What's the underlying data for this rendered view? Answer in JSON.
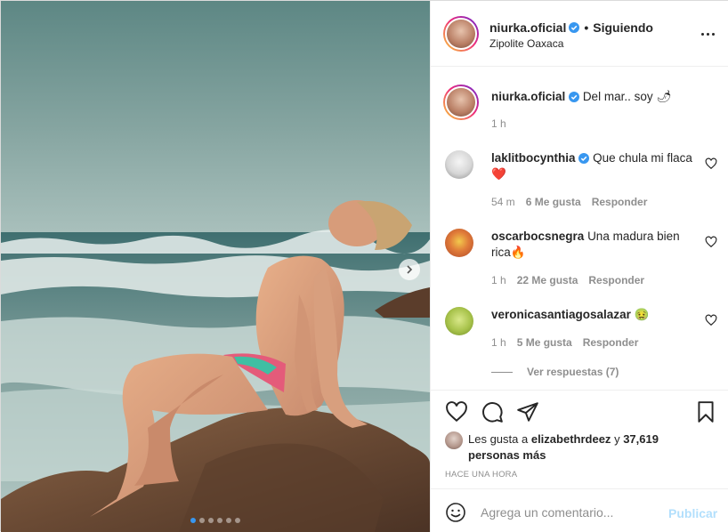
{
  "post": {
    "username": "niurka.oficial",
    "separator": "•",
    "follow_status": "Siguiendo",
    "location": "Zipolite Oaxaca",
    "caption_user": "niurka.oficial",
    "caption_text": "Del mar.. soy 🌶",
    "caption_time": "1 h",
    "carousel": {
      "count": 6,
      "active_index": 0
    }
  },
  "comments": [
    {
      "user": "laklitbocynthia",
      "verified": true,
      "text": "Que chula mi flaca❤️",
      "time": "54 m",
      "likes": "6 Me gusta",
      "reply": "Responder"
    },
    {
      "user": "oscarbocsnegra",
      "verified": false,
      "text": "Una madura bien rica🔥",
      "time": "1 h",
      "likes": "22 Me gusta",
      "reply": "Responder"
    },
    {
      "user": "veronicasantiagosalazar",
      "verified": false,
      "text": "🤢",
      "time": "1 h",
      "likes": "5 Me gusta",
      "reply": "Responder",
      "view_replies": "Ver respuestas (7)"
    }
  ],
  "likes": {
    "prefix": "Les gusta a",
    "user": "elizabethrdeez",
    "conjunction": "y",
    "count": "37,619 personas más"
  },
  "time_ago": "HACE UNA HORA",
  "add_comment": {
    "placeholder": "Agrega un comentario...",
    "publish": "Publicar"
  },
  "colors": {
    "link": "#262626",
    "secondary": "#8e8e8e",
    "verified": "#3897f0",
    "publish_disabled": "#b2dffc",
    "dot_active": "#3897f0"
  }
}
